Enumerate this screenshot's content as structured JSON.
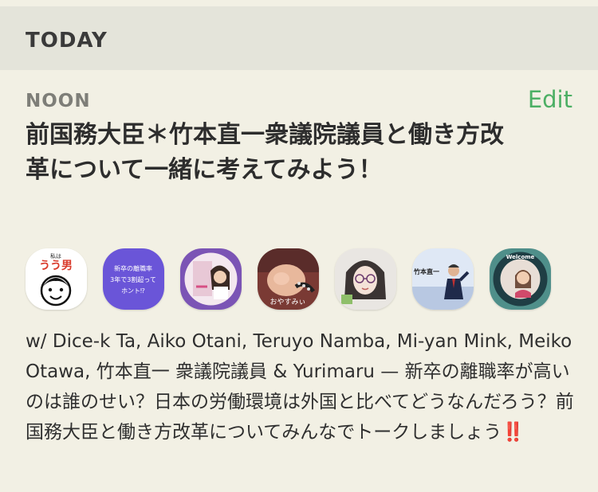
{
  "section": {
    "title": "TODAY"
  },
  "event": {
    "time_label": "NOON",
    "edit_label": "Edit",
    "title": "前国務大臣＊竹本直一衆議院議員と働き方改革について一緒に考えてみよう！",
    "hosts_text": "w/ Dice-k Ta, Aiko Otani, Teruyo Namba, Mi-yan Mink, Meiko Otawa, 竹本直一 衆議院議員 & Yurimaru",
    "description": " — 新卒の離職率が高いのは誰のせい？日本の労働環境は外国と比べてどうなんだろう？前国務大臣と働き方改革についてみんなでトークしましょう",
    "exclamation": "‼️",
    "avatars": [
      {
        "icon": "avatar-uu-man-icon",
        "caption_top": "私は",
        "caption_main": "うう男"
      },
      {
        "icon": "avatar-purple-text-icon",
        "line1": "新卒の離職率",
        "line2": "3年で3割超って",
        "line3": "ホント⁉"
      },
      {
        "icon": "avatar-pink-photo-icon"
      },
      {
        "icon": "avatar-baby-photo-icon",
        "caption": "おやすみぃ"
      },
      {
        "icon": "avatar-glasses-drawing-icon"
      },
      {
        "icon": "avatar-politician-photo-icon",
        "caption": "竹本直一"
      },
      {
        "icon": "avatar-welcome-ring-icon",
        "caption": "Welcome"
      }
    ]
  },
  "colors": {
    "accent_green": "#4caf64",
    "header_bg": "#e4e4da",
    "page_bg": "#f2f0e4",
    "exclamation_red": "#d42b1e"
  }
}
